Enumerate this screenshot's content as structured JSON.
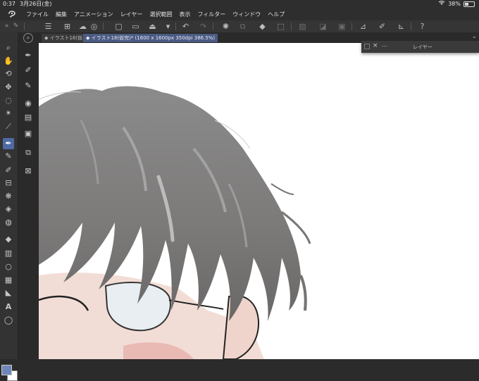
{
  "status_bar": {
    "time": "0:37",
    "date": "3月26日(金)",
    "battery_text": "38%",
    "battery_level": 0.38
  },
  "menu": {
    "items": [
      "ファイル",
      "編集",
      "アニメーション",
      "レイヤー",
      "選択範囲",
      "表示",
      "フィルター",
      "ウィンドウ",
      "ヘルプ"
    ]
  },
  "toolbar": {
    "icons": [
      "menu-icon",
      "new-canvas-icon",
      "cloud-icon",
      "new-file-icon",
      "open-folder-icon",
      "save-icon",
      "undo-icon",
      "redo-icon",
      "loading-icon",
      "copy-icon",
      "fill-icon",
      "transform-icon",
      "clear-icon",
      "fill-selection-icon",
      "crop-icon",
      "ruler-icon",
      "pen-stabilizer-icon",
      "stroke-icon",
      "help-icon"
    ]
  },
  "tabs": {
    "inactive_label": "◆ イラスト16(仮...",
    "active_label": "◆ イラスト18(仮完)* (1600 x 1600px 350dpi 386.5%)"
  },
  "layer_panel": {
    "title": "レイヤー",
    "more": "..."
  },
  "colors": {
    "accent": "#4f6aa3",
    "main_color": "#6f86b8",
    "sub_color": "#ffffff"
  }
}
